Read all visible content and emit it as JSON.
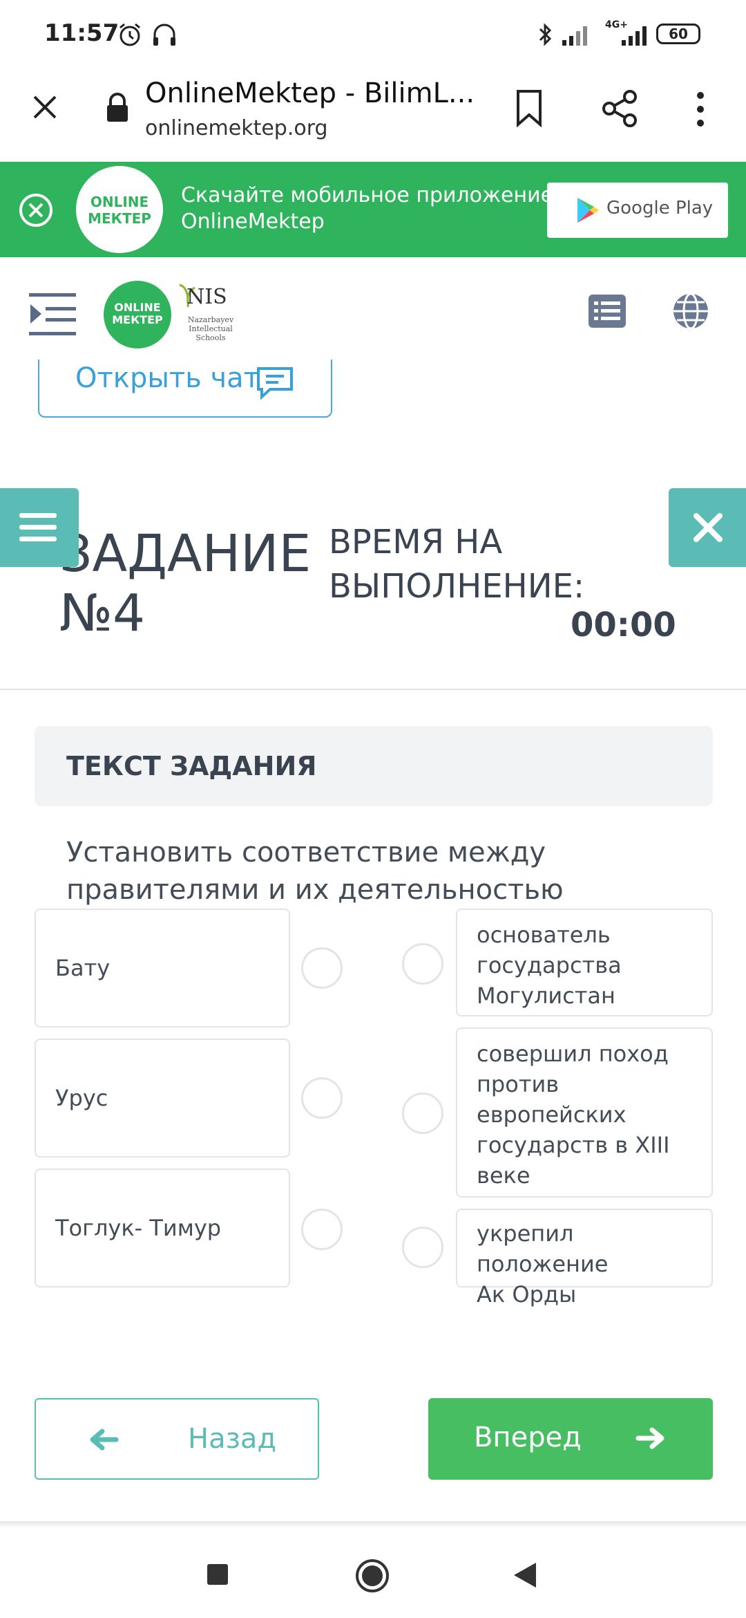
{
  "status_bar": {
    "time": "11:57",
    "battery": "60",
    "network": "4G+"
  },
  "browser": {
    "title": "OnlineMektep - BilimL...",
    "url": "onlinemektep.org"
  },
  "promo": {
    "logo_line1": "ONLINE",
    "logo_line2": "МЕКТЕР",
    "text_line1": "Скачайте мобильное приложение",
    "text_line2": "OnlineMektep",
    "store_label": "Google Play"
  },
  "header": {
    "logo_line1": "ONLINE",
    "logo_line2": "МЕКТЕР",
    "nis_label": "NIS",
    "nis_sub": "Nazarbayev Intellectual Schools"
  },
  "chat": {
    "label": "Открыть чат"
  },
  "task": {
    "title_line1": "ЗАДАНИЕ",
    "title_line2": "№4",
    "time_label_line1": "ВРЕМЯ НА",
    "time_label_line2": "ВЫПОЛНЕНИЕ:",
    "time_value": "00:00",
    "box_label": "ТЕКСТ ЗАДАНИЯ",
    "text_line1": "Установить соответствие между",
    "text_line2": "правителями и их деятельностью"
  },
  "left_items": [
    "Бату",
    "Урус",
    "Тоглук- Тимур"
  ],
  "right_items": [
    [
      "основатель",
      "государства",
      "Могулистан"
    ],
    [
      "совершил поход",
      "против",
      "европейских",
      "государств в XIII",
      "веке"
    ],
    [
      "укрепил положение",
      "Ак Орды"
    ]
  ],
  "nav": {
    "back_label": "Назад",
    "next_label": "Вперед"
  },
  "colors": {
    "green": "#2fb35c",
    "teal": "#5bbcb6",
    "next": "#48be62"
  }
}
